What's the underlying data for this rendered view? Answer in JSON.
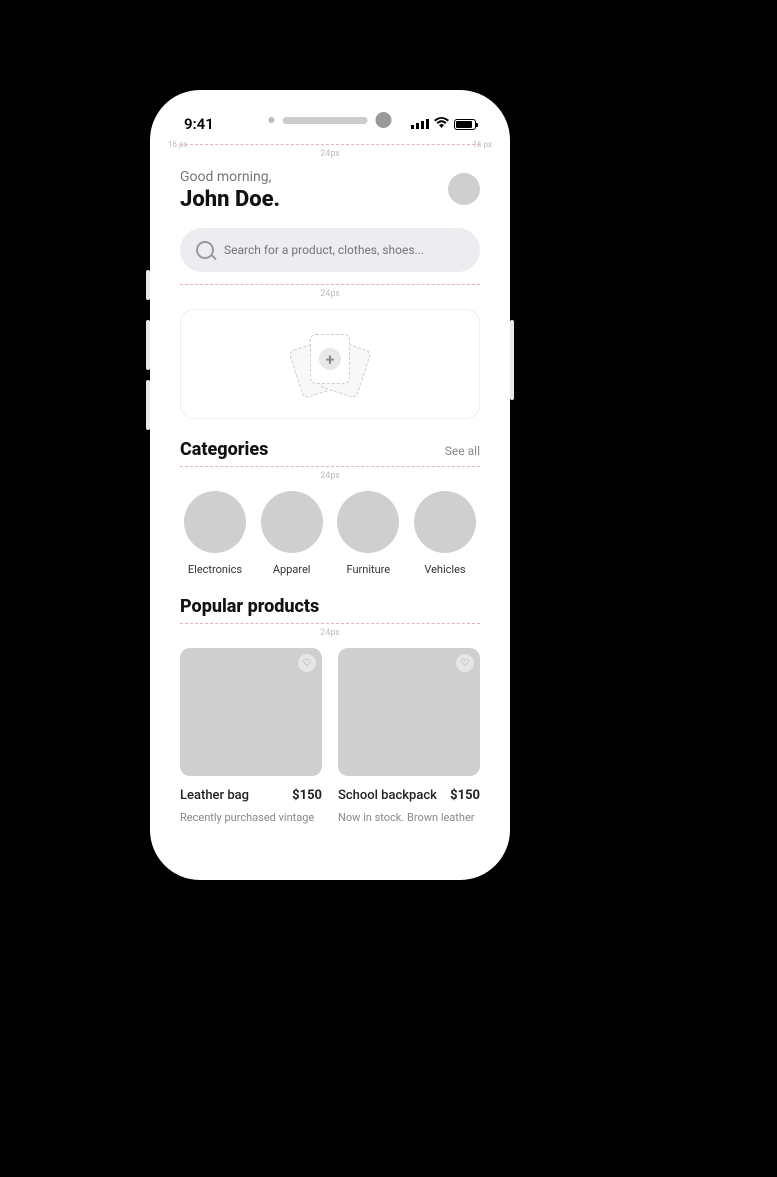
{
  "status": {
    "time": "9:41",
    "left_guide": "16 px",
    "right_guide": "16 px"
  },
  "ruler": "24px",
  "header": {
    "greeting": "Good morning,",
    "username": "John Doe."
  },
  "search": {
    "placeholder": "Search for a product, clothes, shoes..."
  },
  "categories": {
    "title": "Categories",
    "see_all": "See all",
    "items": [
      {
        "label": "Electronics"
      },
      {
        "label": "Apparel"
      },
      {
        "label": "Furniture"
      },
      {
        "label": "Vehicles"
      }
    ]
  },
  "popular": {
    "title": "Popular products",
    "items": [
      {
        "name": "Leather bag",
        "price": "$150",
        "desc": "Recently purchased vintage"
      },
      {
        "name": "School backpack",
        "price": "$150",
        "desc": "Now in stock. Brown leather"
      }
    ]
  }
}
